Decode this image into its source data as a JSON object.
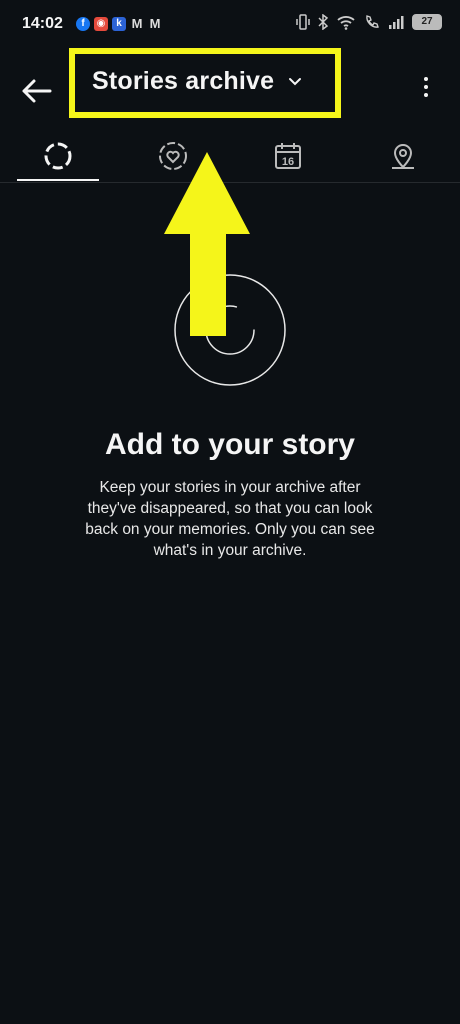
{
  "status_bar": {
    "time": "14:02",
    "notifications": [
      "facebook-icon",
      "app-icon",
      "kk-icon",
      "gmail-icon",
      "gmail-icon"
    ],
    "battery": "27"
  },
  "app_bar": {
    "title": "Stories archive",
    "back_icon": "arrow-left-icon",
    "menu_icon": "more-vertical-icon"
  },
  "tabs": [
    {
      "name": "stories",
      "icon": "stories-ring-icon",
      "active": true
    },
    {
      "name": "highlights",
      "icon": "heart-ring-icon",
      "active": false
    },
    {
      "name": "calendar",
      "icon": "calendar-icon",
      "label": "16",
      "active": false
    },
    {
      "name": "map",
      "icon": "location-pin-icon",
      "active": false
    }
  ],
  "empty_state": {
    "headline": "Add to your story",
    "description": "Keep your stories in your archive after they've disappeared, so that you can look back on your memories. Only you can see what's in your archive."
  },
  "annotation": {
    "highlight_color": "#f5f51a"
  }
}
